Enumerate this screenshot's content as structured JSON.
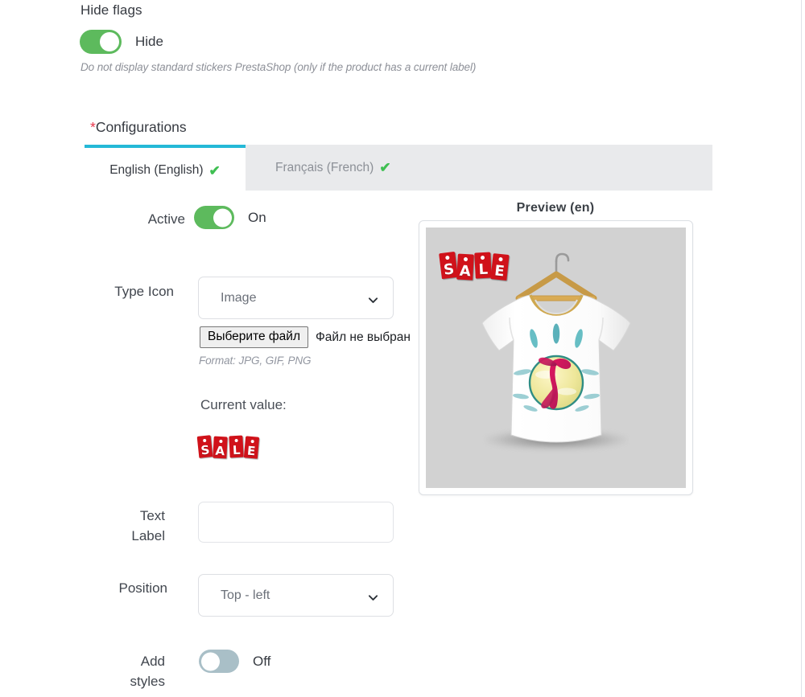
{
  "hide_flags": {
    "label": "Hide flags",
    "toggle_state": "on",
    "toggle_text": "Hide",
    "description": "Do not display standard stickers PrestaShop (only if the product has a current label)"
  },
  "configurations": {
    "required_marker": "*",
    "label": "Configurations",
    "tabs": [
      {
        "label": "English (English)",
        "check": "✔",
        "active": true
      },
      {
        "label": "Français (French)",
        "check": "✔",
        "active": false
      }
    ]
  },
  "form": {
    "active": {
      "label": "Active",
      "toggle_state": "on",
      "toggle_text": "On"
    },
    "type_icon": {
      "label": "Type Icon",
      "select_value": "Image",
      "select_options": [
        "Image"
      ],
      "chevron_icon": "chevron-down-icon",
      "file_button_label": "Выберите файл",
      "file_status": "Файл не выбран",
      "format_note": "Format: JPG, GIF, PNG",
      "current_value_label": "Current value:",
      "current_value_sticker": "SALE"
    },
    "text_label": {
      "label": "Text\nLabel",
      "label_line1": "Text",
      "label_line2": "Label",
      "value": "",
      "placeholder": ""
    },
    "position": {
      "label": "Position",
      "select_value": "Top - left",
      "select_options": [
        "Top - left"
      ],
      "chevron_icon": "chevron-down-icon"
    },
    "add_styles": {
      "label_line1": "Add",
      "label_line2": "styles",
      "toggle_state": "off",
      "toggle_text": "Off"
    }
  },
  "preview": {
    "title": "Preview (en)",
    "sticker_text": "SALE",
    "sticker_position": "top-left",
    "product_alt": "white t-shirt on wooden hanger with colorful graphic print"
  },
  "colors": {
    "toggle_on": "#5dba5d",
    "toggle_off": "#a9bfc7",
    "tab_active_border": "#25b9d7",
    "tabbar_bg": "#e9eaec",
    "required_marker": "#e8344a",
    "check_green": "#3fbf52",
    "sticker_red": "#d0121a",
    "preview_bg": "#d2d2d2",
    "muted_text": "#8d9098"
  }
}
